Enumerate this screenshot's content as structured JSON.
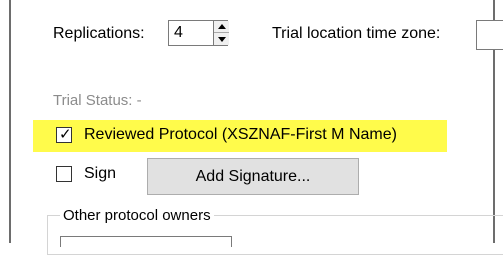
{
  "form": {
    "replications_label": "Replications:",
    "replications_value": "4",
    "timezone_label": "Trial location time zone:",
    "status_text": "Trial Status: -",
    "reviewed_label": "Reviewed Protocol (XSZNAF-First M Name)",
    "reviewed_checked": true,
    "sign_label": "Sign",
    "sign_checked": false,
    "add_signature_label": "Add Signature...",
    "other_owners_label": "Other protocol owners",
    "highlight_color": "#fffb4b"
  }
}
